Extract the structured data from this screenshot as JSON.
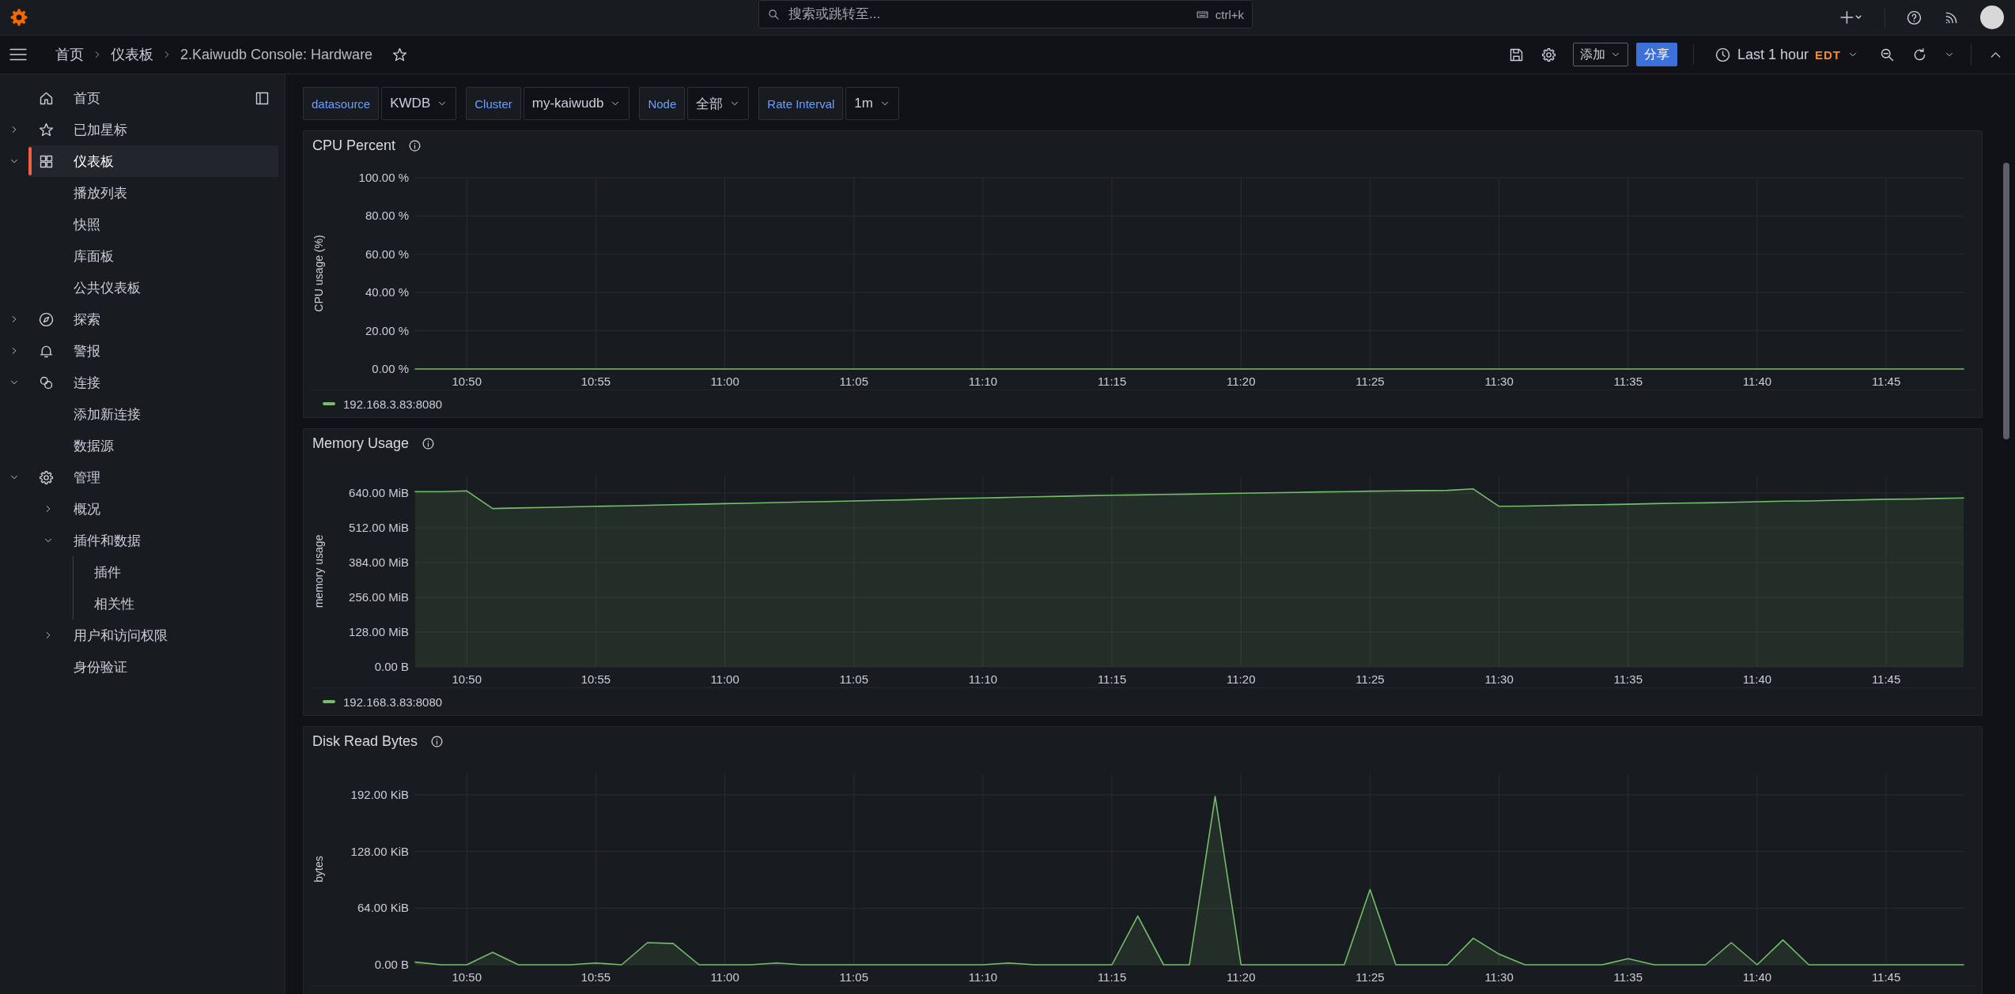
{
  "top_bar": {
    "search": {
      "placeholder": "搜索或跳转至..."
    },
    "shortcut": "ctrl+k"
  },
  "breadcrumbs": [
    "首页",
    "仪表板",
    "2.Kaiwudb Console: Hardware"
  ],
  "toolbar": {
    "add_button": "添加",
    "share_button": "分享",
    "time_range": "Last 1 hour",
    "timezone": "EDT"
  },
  "sidebar": {
    "items": [
      {
        "label": "首页",
        "selected": false
      },
      {
        "label": "已加星标",
        "selected": false,
        "expanded": false
      },
      {
        "label": "仪表板",
        "selected": true,
        "expanded": true,
        "children": [
          {
            "label": "播放列表",
            "selected": false
          },
          {
            "label": "快照",
            "selected": false
          },
          {
            "label": "库面板",
            "selected": false
          },
          {
            "label": "公共仪表板",
            "selected": false
          }
        ]
      },
      {
        "label": "探索",
        "selected": false,
        "expanded": false
      },
      {
        "label": "警报",
        "selected": false,
        "expanded": false
      },
      {
        "label": "连接",
        "selected": false,
        "expanded": true,
        "children": [
          {
            "label": "添加新连接",
            "selected": false
          },
          {
            "label": "数据源",
            "selected": false
          }
        ]
      },
      {
        "label": "管理",
        "selected": false,
        "expanded": true,
        "children": [
          {
            "label": "概况",
            "selected": false,
            "expanded": false
          },
          {
            "label": "插件和数据",
            "selected": false,
            "expanded": true,
            "children": [
              {
                "label": "插件",
                "selected": false
              },
              {
                "label": "相关性",
                "selected": false
              }
            ]
          },
          {
            "label": "用户和访问权限",
            "selected": false,
            "expanded": false
          },
          {
            "label": "身份验证",
            "selected": false
          }
        ]
      }
    ]
  },
  "variables": [
    {
      "label": "datasource",
      "value": "KWDB"
    },
    {
      "label": "Cluster",
      "value": "my-kaiwudb"
    },
    {
      "label": "Node",
      "value": "全部"
    },
    {
      "label": "Rate Interval",
      "value": "1m"
    }
  ],
  "panels": [
    {
      "title": "CPU Percent",
      "chart_data": {
        "type": "line",
        "ylabel": "CPU usage (%)",
        "categories": [
          null,
          null,
          "10:50",
          null,
          null,
          null,
          null,
          "10:55",
          null,
          null,
          null,
          null,
          "11:00",
          null,
          null,
          null,
          null,
          "11:05",
          null,
          null,
          null,
          null,
          "11:10",
          null,
          null,
          null,
          null,
          "11:15",
          null,
          null,
          null,
          null,
          "11:20",
          null,
          null,
          null,
          null,
          "11:25",
          null,
          null,
          null,
          null,
          "11:30",
          null,
          null,
          null,
          null,
          "11:35",
          null,
          null,
          null,
          null,
          "11:40",
          null,
          null,
          null,
          null,
          "11:45",
          null,
          null,
          null
        ],
        "ylim": [
          0,
          100
        ],
        "grid": true,
        "yticks": [
          {
            "value": 0,
            "label": "0.00 %"
          },
          {
            "value": 20,
            "label": "20.00 %"
          },
          {
            "value": 40,
            "label": "40.00 %"
          },
          {
            "value": 60,
            "label": "60.00 %"
          },
          {
            "value": 80,
            "label": "80.00 %"
          },
          {
            "value": 100,
            "label": "100.00 %"
          }
        ],
        "series": [
          {
            "name": "192.168.3.83:8080",
            "color": "#73bf69",
            "values": [
              0,
              0,
              0,
              0,
              0,
              0,
              0,
              0,
              0,
              0,
              0,
              0,
              0,
              0,
              0,
              0,
              0,
              0,
              0,
              0,
              0,
              0,
              0,
              0,
              0,
              0,
              0,
              0,
              0,
              0,
              0,
              0,
              0,
              0,
              0,
              0,
              0,
              0,
              0,
              0,
              0,
              0,
              0,
              0,
              0,
              0,
              0,
              0,
              0,
              0,
              0,
              0,
              0,
              0,
              0,
              0,
              0,
              0,
              0,
              0,
              0
            ]
          }
        ]
      }
    },
    {
      "title": "Memory Usage",
      "chart_data": {
        "type": "area",
        "ylabel": "memory usage",
        "categories": [
          null,
          null,
          "10:50",
          null,
          null,
          null,
          null,
          "10:55",
          null,
          null,
          null,
          null,
          "11:00",
          null,
          null,
          null,
          null,
          "11:05",
          null,
          null,
          null,
          null,
          "11:10",
          null,
          null,
          null,
          null,
          "11:15",
          null,
          null,
          null,
          null,
          "11:20",
          null,
          null,
          null,
          null,
          "11:25",
          null,
          null,
          null,
          null,
          "11:30",
          null,
          null,
          null,
          null,
          "11:35",
          null,
          null,
          null,
          null,
          "11:40",
          null,
          null,
          null,
          null,
          "11:45",
          null,
          null,
          null
        ],
        "ylim": [
          0,
          704
        ],
        "grid": true,
        "yticks": [
          {
            "value": 0,
            "label": "0.00 B"
          },
          {
            "value": 128,
            "label": "128.00 MiB"
          },
          {
            "value": 256,
            "label": "256.00 MiB"
          },
          {
            "value": 384,
            "label": "384.00 MiB"
          },
          {
            "value": 512,
            "label": "512.00 MiB"
          },
          {
            "value": 640,
            "label": "640.00 MiB"
          }
        ],
        "series": [
          {
            "name": "192.168.3.83:8080",
            "color": "#73bf69",
            "values": [
              645,
              645,
              648,
              583,
              585,
              587,
              589,
              591,
              593,
              595,
              597,
              599,
              601,
              603,
              605,
              607,
              609,
              611,
              613,
              615,
              618,
              620,
              622,
              624,
              626,
              628,
              630,
              632,
              633,
              635,
              636,
              638,
              639,
              641,
              642,
              644,
              645,
              647,
              648,
              649,
              650,
              655,
              591,
              592,
              594,
              596,
              597,
              599,
              601,
              603,
              604,
              606,
              608,
              610,
              611,
              613,
              615,
              617,
              618,
              620,
              622
            ]
          }
        ]
      }
    },
    {
      "title": "Disk Read Bytes",
      "chart_data": {
        "type": "area",
        "ylabel": "bytes",
        "categories": [
          null,
          null,
          "10:50",
          null,
          null,
          null,
          null,
          "10:55",
          null,
          null,
          null,
          null,
          "11:00",
          null,
          null,
          null,
          null,
          "11:05",
          null,
          null,
          null,
          null,
          "11:10",
          null,
          null,
          null,
          null,
          "11:15",
          null,
          null,
          null,
          null,
          "11:20",
          null,
          null,
          null,
          null,
          "11:25",
          null,
          null,
          null,
          null,
          "11:30",
          null,
          null,
          null,
          null,
          "11:35",
          null,
          null,
          null,
          null,
          "11:40",
          null,
          null,
          null,
          null,
          "11:45",
          null,
          null,
          null
        ],
        "ylim": [
          0,
          216
        ],
        "grid": true,
        "yticks": [
          {
            "value": 0,
            "label": "0.00 B"
          },
          {
            "value": 64,
            "label": "64.00 KiB"
          },
          {
            "value": 128,
            "label": "128.00 KiB"
          },
          {
            "value": 192,
            "label": "192.00 KiB"
          }
        ],
        "series": [
          {
            "color": "#73bf69",
            "values": [
              3,
              0,
              0,
              14,
              0,
              0,
              0,
              2,
              0,
              25,
              24,
              0,
              0,
              0,
              2,
              0,
              0,
              0,
              0,
              0,
              0,
              0,
              0,
              2,
              0,
              0,
              0,
              0,
              55,
              0,
              0,
              190,
              0,
              0,
              0,
              0,
              0,
              85,
              0,
              0,
              0,
              30,
              12,
              0,
              0,
              0,
              0,
              7,
              0,
              0,
              0,
              25,
              0,
              28,
              0,
              0,
              0,
              0,
              0,
              0,
              0
            ]
          }
        ]
      }
    }
  ]
}
